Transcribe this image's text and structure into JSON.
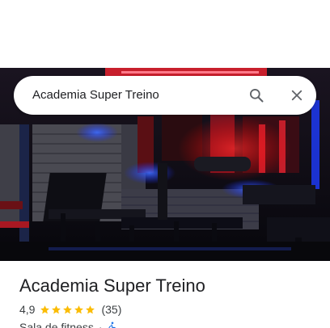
{
  "search": {
    "query": "Academia Super Treino",
    "search_icon": "search-icon",
    "clear_icon": "close-icon"
  },
  "photo": {
    "description_icon": "place-photo"
  },
  "place": {
    "name": "Academia Super Treino",
    "rating": "4,9",
    "rating_stars": 5,
    "review_count": "(35)",
    "category": "Sala de fitness",
    "separator": "·",
    "accessibility_icon": "wheelchair-accessible-icon"
  },
  "colors": {
    "star": "#fbbc04",
    "accessibility": "#1a73e8",
    "text_primary": "#202124",
    "text_secondary": "#3c4043"
  }
}
